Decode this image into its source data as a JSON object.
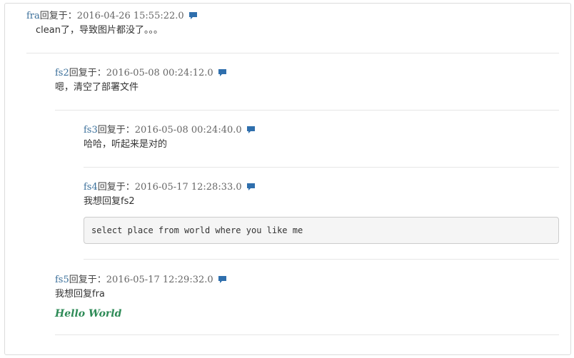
{
  "icons": {
    "reply": "speech-bubble-icon",
    "reply_color": "#2f6fad"
  },
  "comments": [
    {
      "author": "fra",
      "reply_label": "回复于：",
      "date": "2016-04-26 15:55:22.0",
      "body": "clean了，导致图片都没了。。。"
    },
    {
      "author": "fs2",
      "reply_label": "回复于：",
      "date": "2016-05-08 00:24:12.0",
      "body": "嗯，清空了部署文件"
    },
    {
      "author": "fs3",
      "reply_label": "回复于：",
      "date": "2016-05-08 00:24:40.0",
      "body": "哈哈，听起来是对的"
    },
    {
      "author": "fs4",
      "reply_label": "回复于：",
      "date": "2016-05-17 12:28:33.0",
      "body": "我想回复fs2",
      "code": "select place from world where you like me"
    },
    {
      "author": "fs5",
      "reply_label": "回复于：",
      "date": "2016-05-17 12:29:32.0",
      "body": "我想回复fra",
      "emphasis": "Hello World"
    }
  ]
}
